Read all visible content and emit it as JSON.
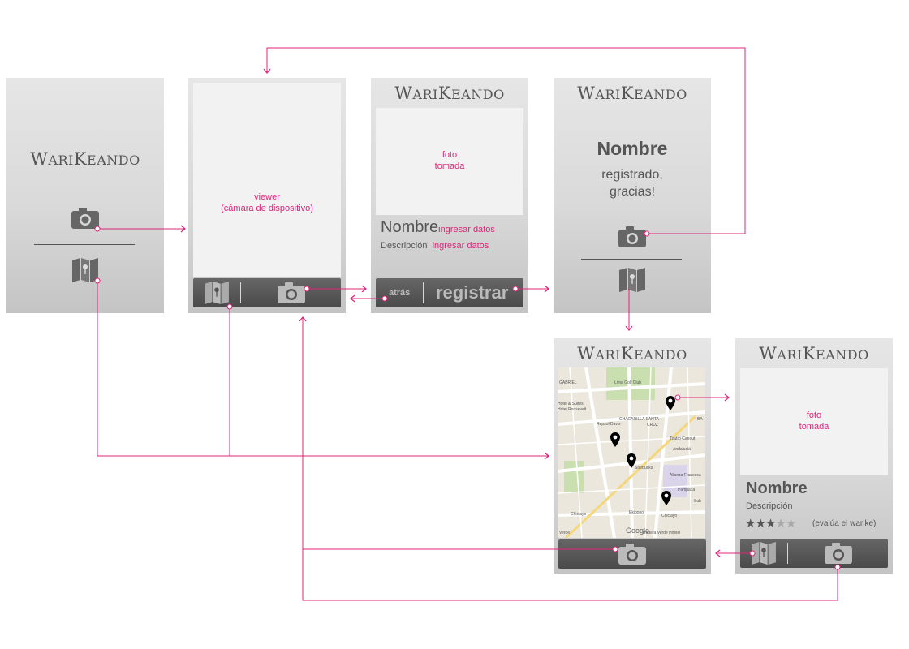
{
  "brand": {
    "lead_initial": "W",
    "lead": "ARI",
    "mid_initial": "K",
    "tail": "EANDO"
  },
  "viewer": {
    "line1": "viewer",
    "line2": "(cámara de dispositivo)"
  },
  "photo_placeholder": {
    "line1": "foto",
    "line2": "tomada"
  },
  "register_form": {
    "name_label": "Nombre",
    "name_hint": "ingresar datos",
    "desc_label": "Descripción",
    "desc_hint": "ingresar datos",
    "back_button": "atrás",
    "register_button": "registrar"
  },
  "confirmation": {
    "title": "Nombre",
    "line1": "registrado,",
    "line2": "gracias!"
  },
  "map": {
    "labels": [
      "GABRIEL",
      "Lima Golf Club",
      "Hotel & Suites",
      "Hotel Roosevelt",
      "Repsol Davis",
      "CHACARILLA SANTA",
      "CRUZ",
      "BA",
      "Teatro Canout",
      "Andaluciá",
      "Starbucks",
      "Alianza Francesa",
      "Pampaca",
      "Sub",
      "Chiclayo",
      "Ekibono",
      "Chiclayo",
      "Verde",
      "Google",
      "Tradera Verde Hostel"
    ],
    "pins": 4
  },
  "detail": {
    "name": "Nombre",
    "description": "Descripción",
    "rating_filled": 3,
    "rating_total": 5,
    "rating_hint": "(evalúa el warike)"
  },
  "colors": {
    "accent": "#e0247a",
    "icon": "#666666",
    "bar": "#555555"
  },
  "icons": [
    "camera-icon",
    "map-icon"
  ]
}
